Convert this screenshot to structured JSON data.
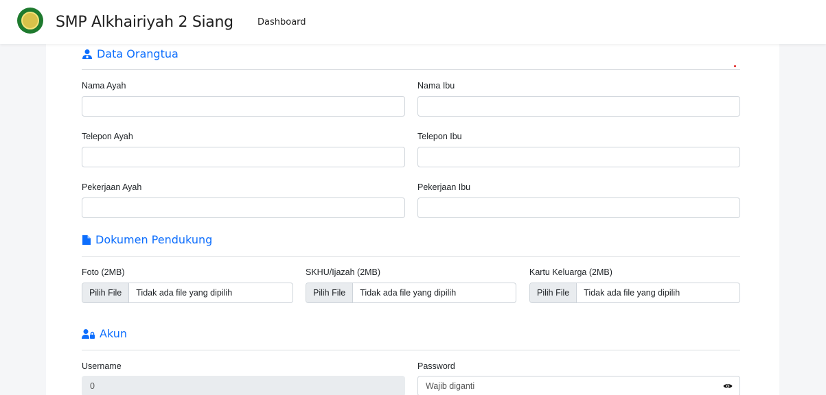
{
  "navbar": {
    "brand": "SMP Alkhairiyah 2 Siang",
    "links": [
      "Dashboard"
    ]
  },
  "sections": {
    "parents": {
      "title": "Data Orangtua",
      "icon": "users-icon"
    },
    "documents": {
      "title": "Dokumen Pendukung",
      "icon": "file-icon"
    },
    "account": {
      "title": "Akun",
      "icon": "user-lock-icon"
    }
  },
  "parents": {
    "father_name_label": "Nama Ayah",
    "mother_name_label": "Nama Ibu",
    "father_phone_label": "Telepon Ayah",
    "mother_phone_label": "Telepon Ibu",
    "father_job_label": "Pekerjaan Ayah",
    "mother_job_label": "Pekerjaan Ibu"
  },
  "documents": {
    "photo_label": "Foto (2MB)",
    "skhu_label": "SKHU/Ijazah (2MB)",
    "kk_label": "Kartu Keluarga (2MB)",
    "button_label": "Pilih File",
    "no_file_text": "Tidak ada file yang dipilih"
  },
  "account": {
    "username_label": "Username",
    "username_value": "0",
    "password_label": "Password",
    "password_placeholder": "Wajib diganti"
  },
  "colors": {
    "accent": "#0d6efd",
    "page_bg": "#f5f6f8",
    "disabled_bg": "#e9ecef"
  }
}
